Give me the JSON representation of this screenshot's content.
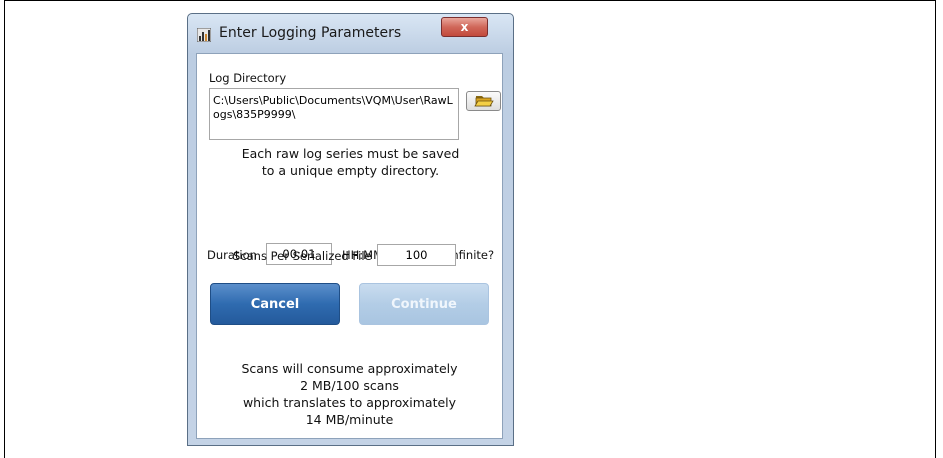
{
  "window": {
    "title": "Enter Logging Parameters",
    "close_glyph": "x"
  },
  "log_directory": {
    "label": "Log Directory",
    "value": "C:\\Users\\Public\\Documents\\VQM\\User\\RawLogs\\835P9999\\",
    "browse_icon": "folder-open-icon"
  },
  "directory_note": {
    "line1": "Each raw log series must be saved",
    "line2": "to a unique empty directory."
  },
  "duration": {
    "label": "Duration",
    "value": "00:01",
    "unit": "HH:MM",
    "infinite_label": "Infinite?",
    "infinite_checked": false
  },
  "scans_per_file": {
    "label": "Scans Per Serialized File",
    "value": "100"
  },
  "buttons": {
    "cancel": "Cancel",
    "continue": "Continue"
  },
  "estimate": {
    "line1": "Scans will consume approximately",
    "line2": "2 MB/100 scans",
    "line3": "which translates to approximately",
    "line4": "14 MB/minute"
  },
  "colors": {
    "cancel_button": "#2f6bb0",
    "continue_button_disabled": "#b3cde6",
    "close_button": "#d0675a"
  }
}
